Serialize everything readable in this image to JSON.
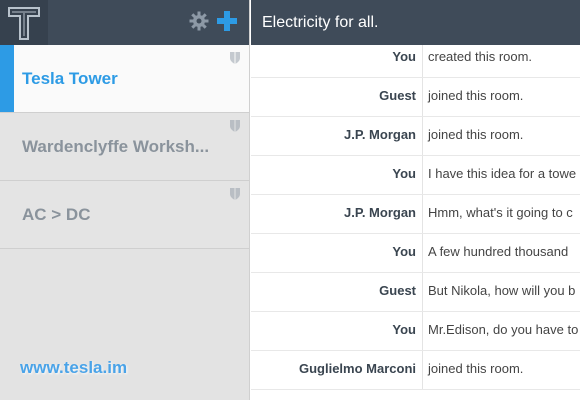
{
  "topbar": {
    "title": "Electricity for all."
  },
  "sidebar": {
    "logo_icon": "tesla-t-logo-icon",
    "settings_icon": "gear-icon",
    "add_icon": "plus-icon",
    "rooms": [
      {
        "label": "Tesla Tower",
        "active": true
      },
      {
        "label": "Wardenclyffe Worksh...",
        "active": false
      },
      {
        "label": "AC > DC",
        "active": false
      }
    ],
    "site_link": "www.tesla.im"
  },
  "messages": [
    {
      "author": "You",
      "text": "created this room."
    },
    {
      "author": "Guest",
      "text": "joined this room."
    },
    {
      "author": "J.P. Morgan",
      "text": "joined this room."
    },
    {
      "author": "You",
      "text": "I have this idea for a towe"
    },
    {
      "author": "J.P. Morgan",
      "text": "Hmm, what's it going to c"
    },
    {
      "author": "You",
      "text": "A few hundred thousand"
    },
    {
      "author": "Guest",
      "text": "But Nikola, how will you b"
    },
    {
      "author": "You",
      "text": "Mr.Edison, do you have to"
    },
    {
      "author": "Guglielmo Marconi",
      "text": "joined this room."
    }
  ],
  "colors": {
    "header_bg": "#3f4b59",
    "accent": "#2d9be5",
    "sidebar_bg": "#e4e4e4"
  }
}
